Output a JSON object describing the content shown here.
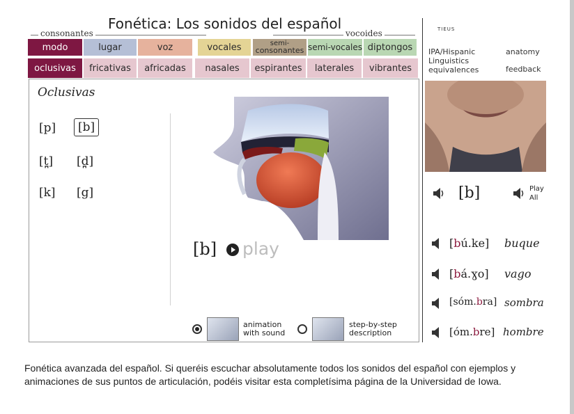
{
  "header": {
    "title": "Fonética:  Los sonidos del español",
    "group_consonantes": "consonantes",
    "group_vocoides": "vocoides"
  },
  "tabs_row1": [
    {
      "label": "modo",
      "style": "dark"
    },
    {
      "label": "lugar",
      "style": "blue"
    },
    {
      "label": "voz",
      "style": "peach"
    },
    {
      "label": "vocales",
      "style": "yellow"
    },
    {
      "label_top": "semi-",
      "label_bottom": "consonantes",
      "style": "tan"
    },
    {
      "label": "semi-vocales",
      "style": "green"
    },
    {
      "label": "diptongos",
      "style": "green"
    }
  ],
  "tabs_row2": [
    {
      "label": "oclusivas",
      "style": "dark"
    },
    {
      "label": "fricativas",
      "style": "rose"
    },
    {
      "label": "africadas",
      "style": "rose"
    },
    {
      "label": "nasales",
      "style": "rose"
    },
    {
      "label": "espirantes",
      "style": "rose"
    },
    {
      "label": "laterales",
      "style": "rose"
    },
    {
      "label": "vibrantes",
      "style": "rose"
    }
  ],
  "section": {
    "title": "Oclusivas",
    "phonemes": [
      "[p]",
      "[b]",
      "[t̪]",
      "[d̪]",
      "[k]",
      "[g]"
    ],
    "selected": "[b]"
  },
  "player": {
    "ipa": "[b]",
    "play_label": "play"
  },
  "options": {
    "animation": "animation\nwith sound",
    "stepbystep": "step-by-step\ndescription",
    "selected": "animation"
  },
  "right": {
    "logo": "TIEUS",
    "link_ipa": "IPA/Hispanic\nLinguistics\nequivalences",
    "link_anatomy": "anatomy",
    "link_feedback": "feedback",
    "current_ipa": "[b]",
    "play_all": "Play\nAll",
    "examples": [
      {
        "pre": "[",
        "hl": "b",
        "post": "ú.ke]",
        "word": "buque"
      },
      {
        "pre": "[",
        "hl": "b",
        "post": "á.ɣo]",
        "word": "vago"
      },
      {
        "pre": "[sóm.",
        "hl": "b",
        "post": "ra]",
        "word": "sombra",
        "post_hl": "ra"
      },
      {
        "pre": "[óm.",
        "hl": "b",
        "post": "re]",
        "word": "hombre",
        "post_hl": "re"
      }
    ]
  },
  "caption": "Fonética avanzada del español. Si queréis escuchar absolutamente todos los sonidos del español con ejemplos y animaciones de sus puntos de articulación, podéis visitar esta completísima página de la Universidad de Iowa.",
  "colors": {
    "accent": "#7e1742",
    "highlight": "#8b1a3e"
  }
}
